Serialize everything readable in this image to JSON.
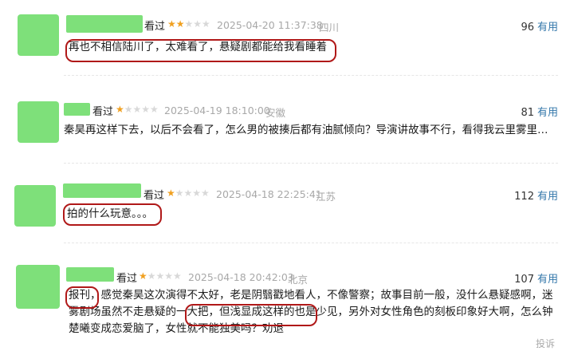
{
  "reviews": [
    {
      "seen_label": "看过",
      "rating": 2,
      "date": "2025-04-20 11:37:38",
      "location": "四川",
      "votes": "96",
      "useful_label": "有用",
      "text": "再也不相信陆川了，太难看了，悬疑剧都能给我看睡着"
    },
    {
      "seen_label": "看过",
      "rating": 1,
      "date": "2025-04-19 18:10:00",
      "location": "安徽",
      "votes": "81",
      "useful_label": "有用",
      "text": "秦昊再这样下去，以后不会看了，怎么男的被揍后都有油腻倾向？导演讲故事不行，看得我云里雾里的…"
    },
    {
      "seen_label": "看过",
      "rating": 1,
      "date": "2025-04-18 22:25:41",
      "location": "江苏",
      "votes": "112",
      "useful_label": "有用",
      "text": "拍的什么玩意。。。"
    },
    {
      "seen_label": "看过",
      "rating": 1,
      "date": "2025-04-18 20:42:03",
      "location": "北京",
      "votes": "107",
      "useful_label": "有用",
      "text_parts": [
        "报刊，",
        "感觉秦昊这次演得不太好，老是阴翳戳地看人，不像警察；故事目前一般，没什么悬疑感啊，迷雾剧场虽然不走悬疑的一大把，",
        "但浅显成这样的也是少见，",
        "另外对女性角色的刻板印象好大啊，怎么钟楚曦变成恋爱脑了，女性就不能独美吗？劝退"
      ]
    }
  ],
  "footer": {
    "report_label": "投诉"
  },
  "colors": {
    "star": "#f0a020",
    "avatar": "#7ee07a",
    "link": "#3377aa",
    "annotation": "#b01818"
  }
}
